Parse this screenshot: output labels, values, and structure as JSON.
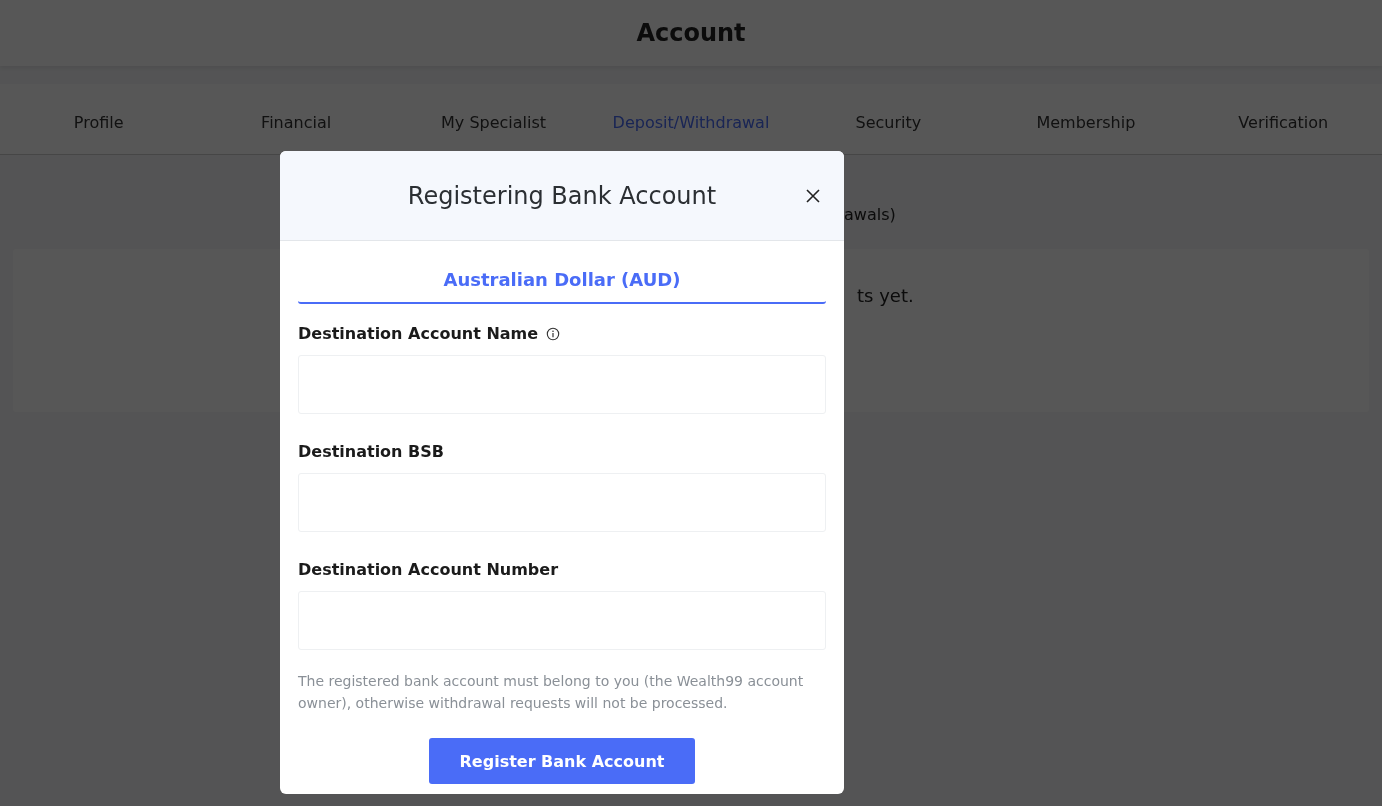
{
  "page": {
    "title": "Account"
  },
  "tabs": [
    {
      "label": "Profile",
      "selected": false
    },
    {
      "label": "Financial",
      "selected": false
    },
    {
      "label": "My Specialist",
      "selected": false
    },
    {
      "label": "Deposit/Withdrawal",
      "selected": true
    },
    {
      "label": "Security",
      "selected": false
    },
    {
      "label": "Membership",
      "selected": false
    },
    {
      "label": "Verification",
      "selected": false
    }
  ],
  "notice": "awals)",
  "card_text": "ts yet.",
  "modal": {
    "title": "Registering Bank Account",
    "currency_tabs": [
      {
        "label": "Australian Dollar (AUD)",
        "selected": true
      }
    ],
    "fields": [
      {
        "kind": "with_info",
        "label": "Destination Account Name"
      },
      {
        "kind": "plain",
        "label": "Destination BSB"
      },
      {
        "kind": "plain",
        "label": "Destination Account Number"
      }
    ],
    "note": "The registered bank account must belong to you (the Wealth99 account owner), otherwise withdrawal requests will not be processed.",
    "submit": "Register Bank Account"
  }
}
